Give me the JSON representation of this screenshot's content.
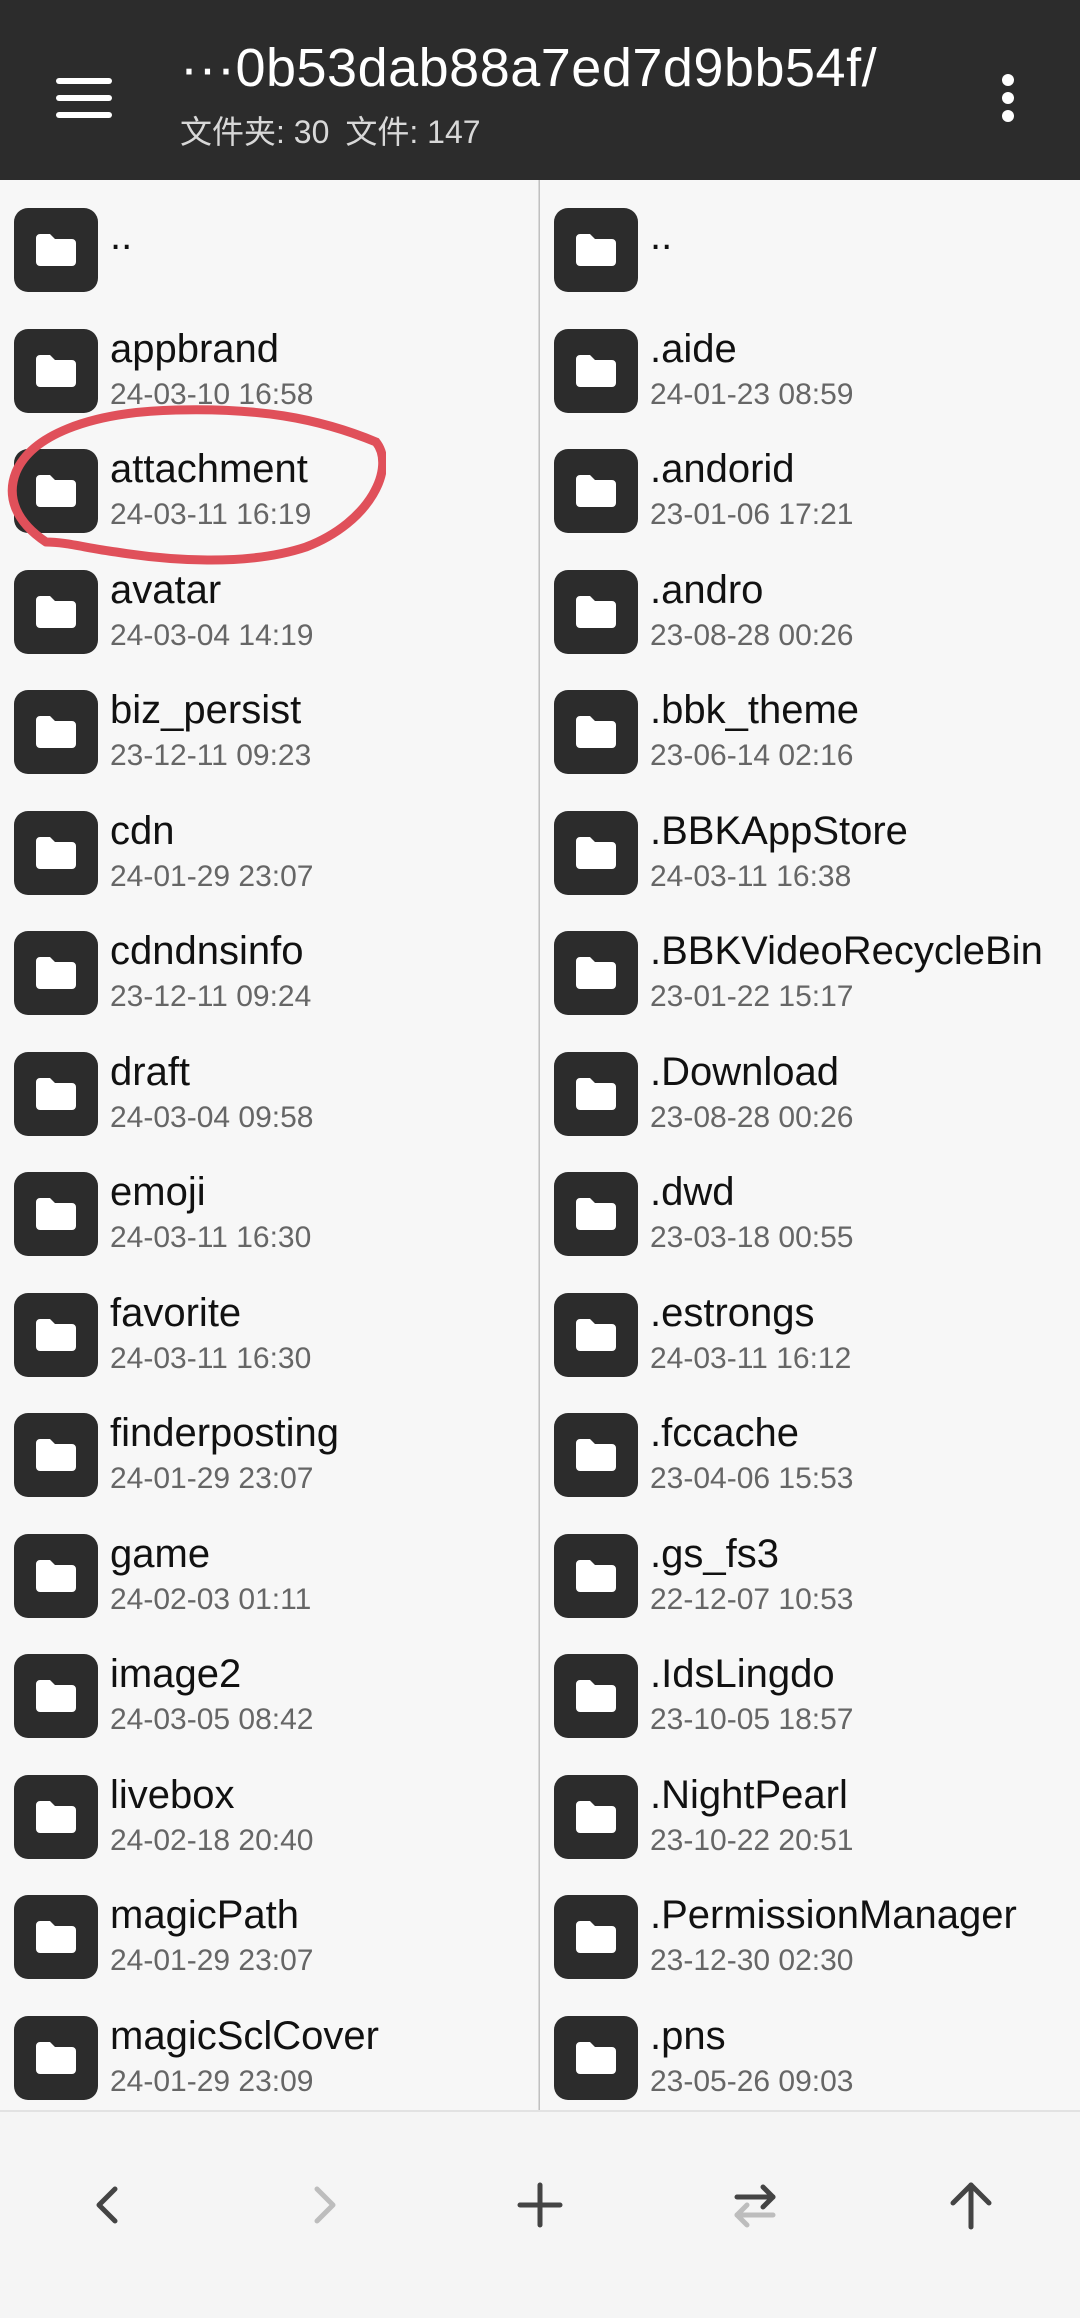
{
  "header": {
    "path": "···0b53dab88a7ed7d9bb54f/",
    "folders_label": "文件夹: 30",
    "files_label": "文件: 147"
  },
  "left_pane": {
    "items": [
      {
        "name": "..",
        "date": ""
      },
      {
        "name": "appbrand",
        "date": "24-03-10 16:58"
      },
      {
        "name": "attachment",
        "date": "24-03-11 16:19"
      },
      {
        "name": "avatar",
        "date": "24-03-04 14:19"
      },
      {
        "name": "biz_persist",
        "date": "23-12-11 09:23"
      },
      {
        "name": "cdn",
        "date": "24-01-29 23:07"
      },
      {
        "name": "cdndnsinfo",
        "date": "23-12-11 09:24"
      },
      {
        "name": "draft",
        "date": "24-03-04 09:58"
      },
      {
        "name": "emoji",
        "date": "24-03-11 16:30"
      },
      {
        "name": "favorite",
        "date": "24-03-11 16:30"
      },
      {
        "name": "finderposting",
        "date": "24-01-29 23:07"
      },
      {
        "name": "game",
        "date": "24-02-03 01:11"
      },
      {
        "name": "image2",
        "date": "24-03-05 08:42"
      },
      {
        "name": "livebox",
        "date": "24-02-18 20:40"
      },
      {
        "name": "magicPath",
        "date": "24-01-29 23:07"
      },
      {
        "name": "magicSclCover",
        "date": "24-01-29 23:09"
      }
    ]
  },
  "right_pane": {
    "items": [
      {
        "name": "..",
        "date": ""
      },
      {
        "name": ".aide",
        "date": "24-01-23 08:59"
      },
      {
        "name": ".andorid",
        "date": "23-01-06 17:21"
      },
      {
        "name": ".andro",
        "date": "23-08-28 00:26"
      },
      {
        "name": ".bbk_theme",
        "date": "23-06-14 02:16"
      },
      {
        "name": ".BBKAppStore",
        "date": "24-03-11 16:38"
      },
      {
        "name": ".BBKVideoRecycleBin",
        "date": "23-01-22 15:17"
      },
      {
        "name": ".Download",
        "date": "23-08-28 00:26"
      },
      {
        "name": ".dwd",
        "date": "23-03-18 00:55"
      },
      {
        "name": ".estrongs",
        "date": "24-03-11 16:12"
      },
      {
        "name": ".fccache",
        "date": "23-04-06 15:53"
      },
      {
        "name": ".gs_fs3",
        "date": "22-12-07 10:53"
      },
      {
        "name": ".IdsLingdo",
        "date": "23-10-05 18:57"
      },
      {
        "name": ".NightPearl",
        "date": "23-10-22 20:51"
      },
      {
        "name": ".PermissionManager",
        "date": "23-12-30 02:30"
      },
      {
        "name": ".pns",
        "date": "23-05-26 09:03"
      }
    ]
  },
  "toolbar": {
    "buttons": [
      "back-icon",
      "forward-icon",
      "add-icon",
      "swap-panes-icon",
      "up-directory-icon"
    ]
  },
  "colors": {
    "appbar": "#2c2c2c",
    "folder_icon_bg": "#2c2c2c",
    "annotation": "#e0505a",
    "disabled": "#bdbdbd"
  }
}
